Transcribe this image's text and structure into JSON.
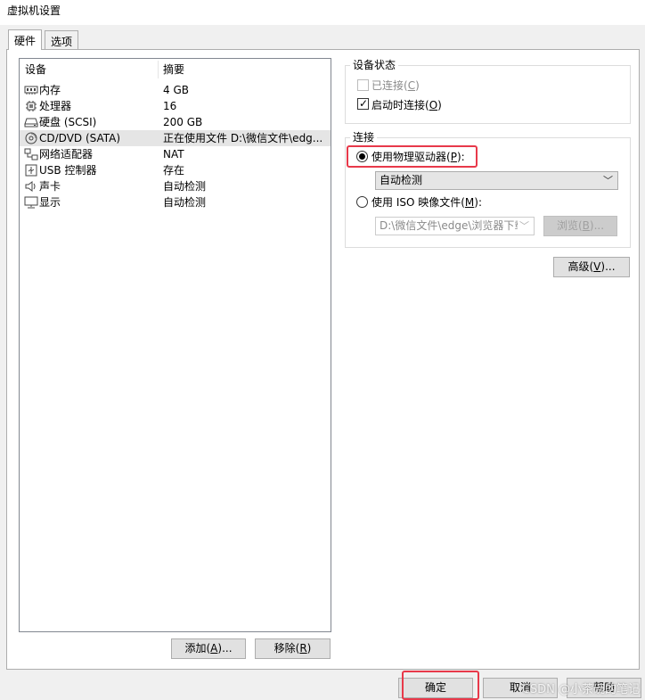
{
  "window": {
    "title": "虚拟机设置"
  },
  "tabs": [
    {
      "label": "硬件"
    },
    {
      "label": "选项"
    }
  ],
  "device_list": {
    "columns": {
      "device": "设备",
      "summary": "摘要"
    },
    "rows": [
      {
        "name": "内存",
        "summary": "4 GB",
        "icon": "memory-icon"
      },
      {
        "name": "处理器",
        "summary": "16",
        "icon": "processor-icon"
      },
      {
        "name": "硬盘 (SCSI)",
        "summary": "200 GB",
        "icon": "hard-disk-icon"
      },
      {
        "name": "CD/DVD (SATA)",
        "summary": "正在使用文件 D:\\微信文件\\edg...",
        "icon": "cd-dvd-icon"
      },
      {
        "name": "网络适配器",
        "summary": "NAT",
        "icon": "network-adapter-icon"
      },
      {
        "name": "USB 控制器",
        "summary": "存在",
        "icon": "usb-icon"
      },
      {
        "name": "声卡",
        "summary": "自动检测",
        "icon": "sound-card-icon"
      },
      {
        "name": "显示",
        "summary": "自动检测",
        "icon": "display-icon"
      }
    ]
  },
  "list_buttons": {
    "add": {
      "text": "添加(",
      "key": "A",
      "tail": ")..."
    },
    "remove": {
      "text": "移除(",
      "key": "R",
      "tail": ")"
    }
  },
  "device_status": {
    "title": "设备状态",
    "connected": {
      "text": "已连接(",
      "key": "C",
      "tail": ")"
    },
    "connect_on_power": {
      "text": "启动时连接(",
      "key": "O",
      "tail": ")"
    }
  },
  "connection": {
    "title": "连接",
    "use_physical": {
      "text": "使用物理驱动器(",
      "key": "P",
      "tail": "):"
    },
    "physical_drive_value": "自动检测",
    "use_iso": {
      "text": "使用 ISO 映像文件(",
      "key": "M",
      "tail": "):"
    },
    "iso_path_value": "D:\\微信文件\\edge\\浏览器下载",
    "browse": {
      "text": "浏览(",
      "key": "B",
      "tail": ")..."
    }
  },
  "advanced": {
    "text": "高级(",
    "key": "V",
    "tail": ")..."
  },
  "footer": {
    "ok": "确定",
    "cancel": "取消",
    "help": "帮助"
  },
  "watermark": "CSDN @小茶碗的笔记",
  "colors": {
    "highlight": "#e8394a",
    "selected_row": "#e5e5e5"
  }
}
